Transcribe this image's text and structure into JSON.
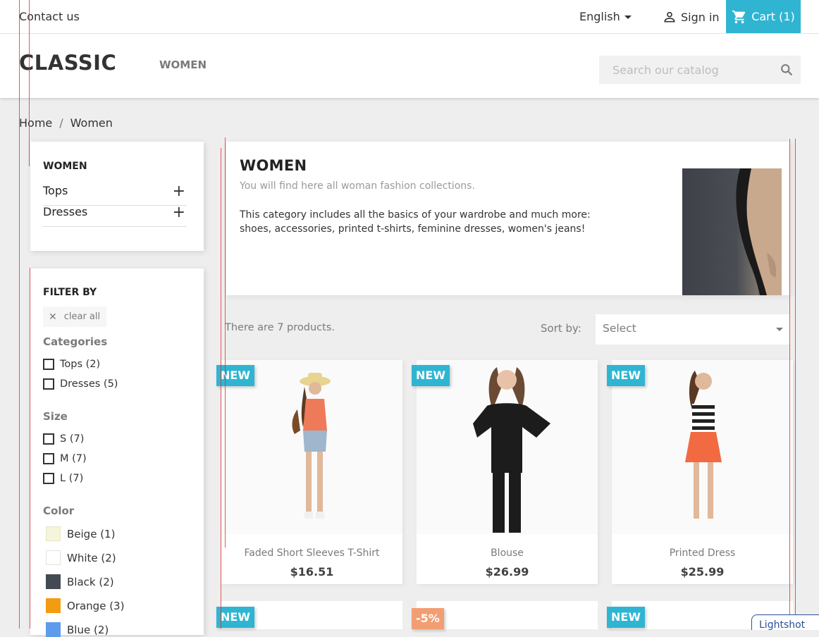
{
  "topbar": {
    "contact": "Contact us",
    "language": "English",
    "signin": "Sign in",
    "cart": "Cart (1)"
  },
  "header": {
    "logo": "CLASSIC",
    "menu_women": "WOMEN",
    "search_placeholder": "Search our catalog"
  },
  "breadcrumb": {
    "home": "Home",
    "separator": "/",
    "current": "Women"
  },
  "category_tree": {
    "title": "WOMEN",
    "items": [
      {
        "label": "Tops"
      },
      {
        "label": "Dresses"
      }
    ]
  },
  "filters": {
    "title": "FILTER BY",
    "clear_all": "clear all",
    "categories_label": "Categories",
    "categories": [
      "Tops (2)",
      "Dresses (5)"
    ],
    "size_label": "Size",
    "sizes": [
      "S (7)",
      "M (7)",
      "L (7)"
    ],
    "color_label": "Color",
    "colors": [
      {
        "label": "Beige (1)",
        "hex": "#f5f5dc"
      },
      {
        "label": "White (2)",
        "hex": "#ffffff"
      },
      {
        "label": "Black (2)",
        "hex": "#434a54"
      },
      {
        "label": "Orange (3)",
        "hex": "#f39c11"
      },
      {
        "label": "Blue (2)",
        "hex": "#5d9cec"
      }
    ]
  },
  "category_block": {
    "title": "WOMEN",
    "subtitle": "You will find here all woman fashion collections.",
    "desc_line1": "This category includes all the basics of your wardrobe and much more:",
    "desc_line2": "shoes, accessories, printed t-shirts, feminine dresses, women's jeans!"
  },
  "listing": {
    "count": "There are 7 products.",
    "sort_label": "Sort by:",
    "sort_value": "Select"
  },
  "products": [
    {
      "badge": "NEW",
      "name": "Faded Short Sleeves T-Shirt",
      "price": "$16.51"
    },
    {
      "badge": "NEW",
      "name": "Blouse",
      "price": "$26.99"
    },
    {
      "badge": "NEW",
      "name": "Printed Dress",
      "price": "$25.99"
    }
  ],
  "products_row2": [
    {
      "badge": "NEW"
    },
    {
      "badge": "-5%"
    },
    {
      "badge": "NEW"
    }
  ],
  "overlay": {
    "lightshot": "Lightshot"
  },
  "colors": {
    "accent": "#2fb5d2",
    "sale": "#f39d72",
    "guide": "#e0302b"
  }
}
